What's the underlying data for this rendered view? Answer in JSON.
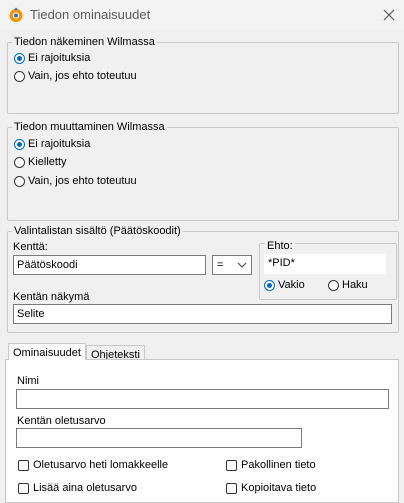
{
  "window": {
    "title": "Tiedon ominaisuudet",
    "icon": "wilma-logo-icon",
    "close_icon": "close-icon"
  },
  "visibility_group": {
    "legend": "Tiedon näkeminen Wilmassa",
    "options": [
      {
        "label": "Ei rajoituksia",
        "checked": true
      },
      {
        "label": "Vain, jos ehto toteutuu",
        "checked": false
      }
    ]
  },
  "edit_group": {
    "legend": "Tiedon muuttaminen Wilmassa",
    "options": [
      {
        "label": "Ei rajoituksia",
        "checked": true
      },
      {
        "label": "Kielletty",
        "checked": false
      },
      {
        "label": "Vain, jos ehto toteutuu",
        "checked": false
      }
    ]
  },
  "list_group": {
    "legend": "Valintalistan sisältö (Päätöskoodit)",
    "field_label": "Kenttä:",
    "field_value": "Päätöskoodi",
    "operator_value": "=",
    "condition_label": "Ehto:",
    "condition_value": "*PID*",
    "condition_options": [
      {
        "label": "Vakio",
        "checked": true
      },
      {
        "label": "Haku",
        "checked": false
      }
    ],
    "display_label": "Kentän näkymä",
    "display_value": "Selite"
  },
  "tabs": [
    {
      "label": "Ominaisuudet",
      "active": true
    },
    {
      "label": "Ohjeteksti",
      "active": false
    }
  ],
  "properties": {
    "name_label": "Nimi",
    "name_value": "",
    "default_label": "Kentän oletusarvo",
    "default_value": "",
    "checkboxes": [
      {
        "label": "Oletusarvo heti lomakkeelle",
        "checked": false
      },
      {
        "label": "Pakollinen tieto",
        "checked": false
      },
      {
        "label": "Lisää aina oletusarvo",
        "checked": false
      },
      {
        "label": "Kopioitava tieto",
        "checked": false
      }
    ]
  },
  "colors": {
    "accent": "#0067c0",
    "window_bg": "#f0f0f0",
    "border": "#c8c8c8"
  }
}
